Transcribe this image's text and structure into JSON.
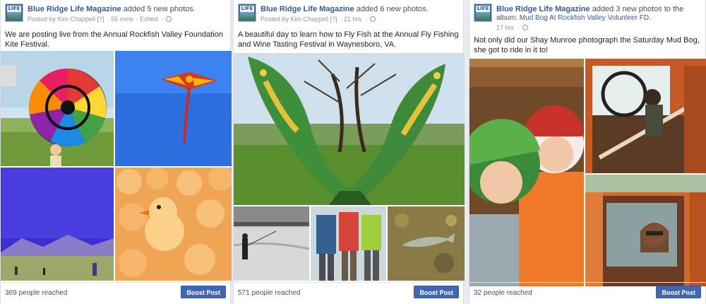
{
  "posts": [
    {
      "page_name": "Blue Ridge Life Magazine",
      "action": "added 5 new photos.",
      "posted_by": "Posted by Kim Chappell",
      "help": "[?]",
      "time": "55 mins",
      "edited": "Edited",
      "message": "We are posting live from the Annual Rockfish Valley Foundation Kite Festival.",
      "reach": "369 people reached",
      "boost_label": "Boost Post"
    },
    {
      "page_name": "Blue Ridge Life Magazine",
      "action": "added 6 new photos.",
      "posted_by": "Posted by Kim Chappell",
      "help": "[?]",
      "time": "21 hrs",
      "message": "A beautiful day to learn how to Fly Fish at the Annual Fly Fishing and Wine Tasting Festival in Waynesboro, VA.",
      "reach": "571 people reached",
      "boost_label": "Boost Post"
    },
    {
      "page_name": "Blue Ridge Life Magazine",
      "action": "added 3 new photos to the",
      "album_prefix": "album:",
      "album": "Mud Bog At Rockfish Valley Volunteer FD.",
      "time": "17 hrs",
      "message": "Not only did our Shay Munroe photograph the Saturday Mud Bog, she got to ride in it to!",
      "reach": "32 people reached",
      "boost_label": "Boost Post"
    }
  ],
  "icons": {
    "avatar": "blue-ridge-life-logo",
    "privacy": "globe-icon"
  }
}
